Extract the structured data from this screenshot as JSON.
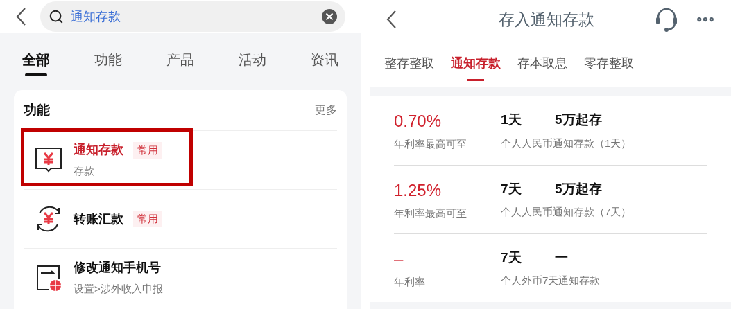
{
  "search_screen": {
    "search": {
      "query": "通知存款"
    },
    "tabs": [
      {
        "label": "全部",
        "selected": true
      },
      {
        "label": "功能",
        "selected": false
      },
      {
        "label": "产品",
        "selected": false
      },
      {
        "label": "活动",
        "selected": false
      },
      {
        "label": "资讯",
        "selected": false
      }
    ],
    "section": {
      "title": "功能",
      "more": "更多",
      "items": [
        {
          "kind": "deposit",
          "title": "通知存款",
          "tag": "常用",
          "subtitle": "存款",
          "highlighted": true,
          "matched": true
        },
        {
          "kind": "transfer",
          "title": "转账汇款",
          "tag": "常用",
          "highlighted": false,
          "matched": false
        },
        {
          "kind": "phone",
          "title": "修改通知手机号",
          "subtitle": "设置>涉外收入申报",
          "highlighted": false,
          "matched": false
        }
      ]
    }
  },
  "deposit_screen": {
    "title": "存入通知存款",
    "tabs": [
      {
        "label": "整存整取",
        "selected": false
      },
      {
        "label": "通知存款",
        "selected": true
      },
      {
        "label": "存本取息",
        "selected": false
      },
      {
        "label": "零存整取",
        "selected": false
      }
    ],
    "products": [
      {
        "rate": "0.70%",
        "rate_label": "年利率最高可至",
        "term": "1天",
        "minimum": "5万起存",
        "name": "个人人民币通知存款（1天）"
      },
      {
        "rate": "1.25%",
        "rate_label": "年利率最高可至",
        "term": "7天",
        "minimum": "5万起存",
        "name": "个人人民币通知存款（7天）"
      },
      {
        "rate": "–",
        "rate_label": "年利率",
        "term": "7天",
        "minimum": "一",
        "name": "个人外币7天通知存款"
      }
    ]
  }
}
